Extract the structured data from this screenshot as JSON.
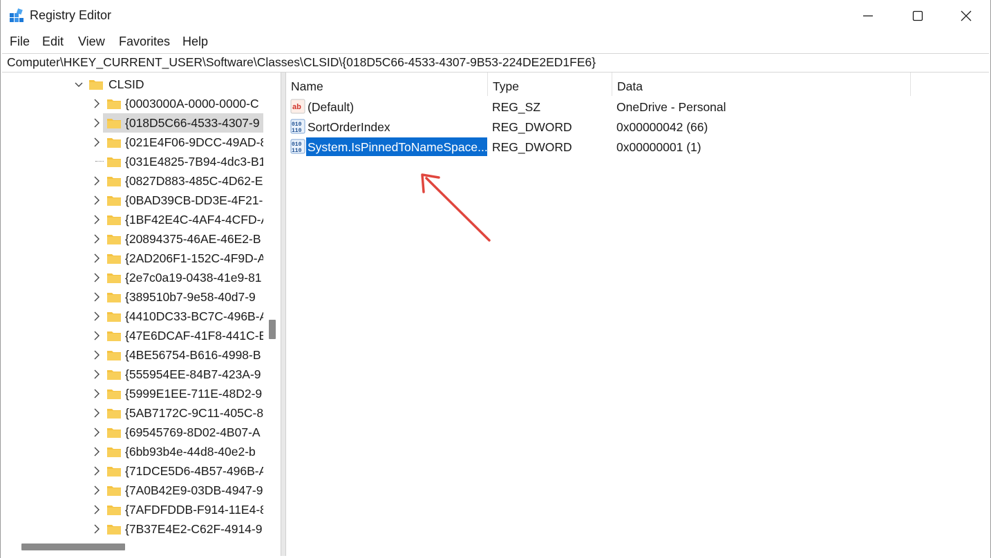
{
  "window": {
    "title": "Registry Editor",
    "controls": [
      "minimize",
      "maximize",
      "close"
    ]
  },
  "menu": [
    "File",
    "Edit",
    "View",
    "Favorites",
    "Help"
  ],
  "address": "Computer\\HKEY_CURRENT_USER\\Software\\Classes\\CLSID\\{018D5C66-4533-4307-9B53-224DE2ED1FE6}",
  "tree": {
    "parent": "CLSID",
    "items": [
      {
        "label": "{0003000A-0000-0000-C",
        "expandable": true,
        "selected": false
      },
      {
        "label": "{018D5C66-4533-4307-9",
        "expandable": true,
        "selected": true
      },
      {
        "label": "{021E4F06-9DCC-49AD-8",
        "expandable": true,
        "selected": false
      },
      {
        "label": "{031E4825-7B94-4dc3-B1",
        "expandable": false,
        "selected": false
      },
      {
        "label": "{0827D883-485C-4D62-E",
        "expandable": true,
        "selected": false
      },
      {
        "label": "{0BAD39CB-DD3E-4F21-9",
        "expandable": true,
        "selected": false
      },
      {
        "label": "{1BF42E4C-4AF4-4CFD-A",
        "expandable": true,
        "selected": false
      },
      {
        "label": "{20894375-46AE-46E2-B",
        "expandable": true,
        "selected": false
      },
      {
        "label": "{2AD206F1-152C-4F9D-A",
        "expandable": true,
        "selected": false
      },
      {
        "label": "{2e7c0a19-0438-41e9-81",
        "expandable": true,
        "selected": false
      },
      {
        "label": "{389510b7-9e58-40d7-9",
        "expandable": true,
        "selected": false
      },
      {
        "label": "{4410DC33-BC7C-496B-A",
        "expandable": true,
        "selected": false
      },
      {
        "label": "{47E6DCAF-41F8-441C-B",
        "expandable": true,
        "selected": false
      },
      {
        "label": "{4BE56754-B616-4998-B",
        "expandable": true,
        "selected": false
      },
      {
        "label": "{555954EE-84B7-423A-9",
        "expandable": true,
        "selected": false
      },
      {
        "label": "{5999E1EE-711E-48D2-9",
        "expandable": true,
        "selected": false
      },
      {
        "label": "{5AB7172C-9C11-405C-8",
        "expandable": true,
        "selected": false
      },
      {
        "label": "{69545769-8D02-4B07-A",
        "expandable": true,
        "selected": false
      },
      {
        "label": "{6bb93b4e-44d8-40e2-b",
        "expandable": true,
        "selected": false
      },
      {
        "label": "{71DCE5D6-4B57-496B-A",
        "expandable": true,
        "selected": false
      },
      {
        "label": "{7A0B42E9-03DB-4947-9",
        "expandable": true,
        "selected": false
      },
      {
        "label": "{7AFDFDDB-F914-11E4-8",
        "expandable": true,
        "selected": false
      },
      {
        "label": "{7B37E4E2-C62F-4914-9",
        "expandable": true,
        "selected": false
      }
    ]
  },
  "list": {
    "columns": [
      "Name",
      "Type",
      "Data"
    ],
    "rows": [
      {
        "name": "(Default)",
        "type": "REG_SZ",
        "data": "OneDrive - Personal",
        "icon": "string-value-icon",
        "selected": false
      },
      {
        "name": "SortOrderIndex",
        "type": "REG_DWORD",
        "data": "0x00000042 (66)",
        "icon": "binary-value-icon",
        "selected": false
      },
      {
        "name": "System.IsPinnedToNameSpace...",
        "type": "REG_DWORD",
        "data": "0x00000001 (1)",
        "icon": "binary-value-icon",
        "selected": true
      }
    ]
  },
  "colors": {
    "selection": "#0a6cd1",
    "folder": "#f5c342",
    "annotation_arrow": "#e0463e"
  }
}
